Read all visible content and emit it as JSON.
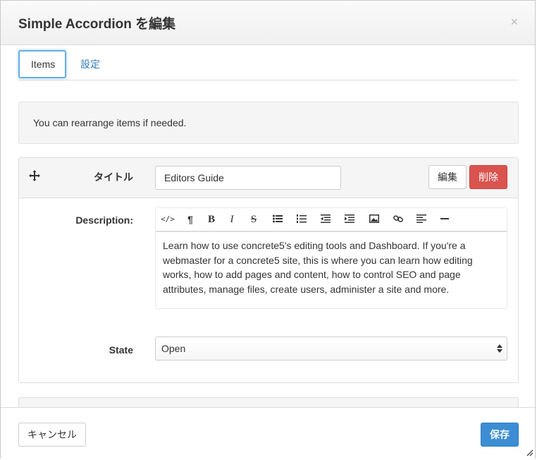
{
  "dialog": {
    "title": "Simple Accordion を編集",
    "close_label": "×"
  },
  "tabs": [
    {
      "label": "Items",
      "active": true
    },
    {
      "label": "設定",
      "active": false
    }
  ],
  "notice": "You can rearrange items if needed.",
  "item": {
    "title_label": "タイトル",
    "title_value": "Editors Guide",
    "edit_button": "編集",
    "delete_button": "削除",
    "description_label": "Description:",
    "description_text": "Learn how to use concrete5's editing tools and Dashboard. If you're a webmaster for a concrete5 site, this is where you can learn how editing works, how to add pages and content, how to control SEO and page attributes, manage files, create users, administer a site and more.",
    "state_label": "State",
    "state_value": "Open",
    "toolbar": {
      "code": "</>",
      "paragraph": "¶",
      "bold": "B",
      "italic": "I",
      "strike": "S"
    }
  },
  "footer": {
    "cancel_button": "キャンセル",
    "save_button": "保存"
  },
  "colors": {
    "accent": "#3c8dd4",
    "danger": "#d9534f",
    "link": "#337ab7"
  }
}
